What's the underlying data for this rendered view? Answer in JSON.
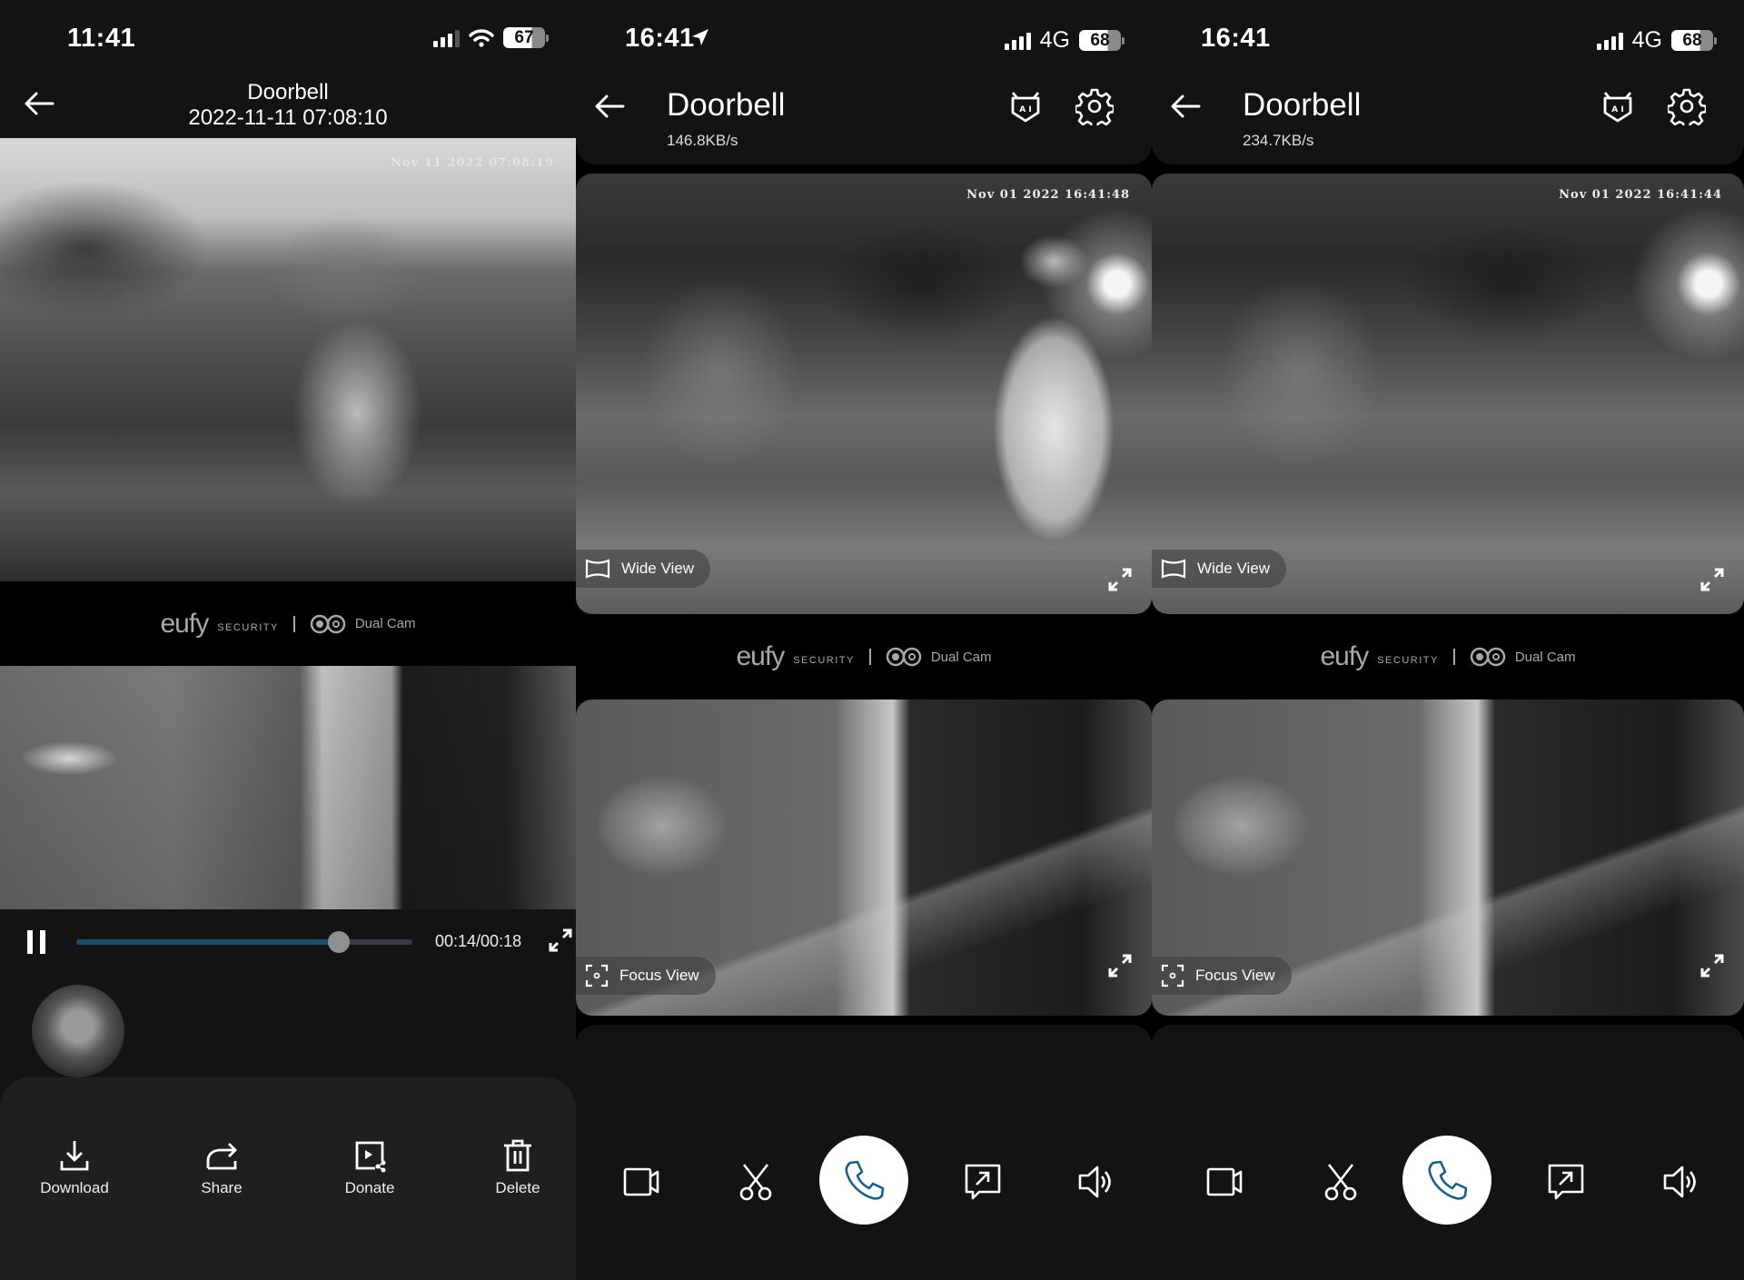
{
  "colors": {
    "accent": "#1a4d68",
    "call_icon": "#1a5f85",
    "sheet_bg": "#1e1f21",
    "header_bg": "#121315"
  },
  "playback_screen": {
    "status_bar": {
      "time": "11:41",
      "battery": "67",
      "network": "wifi"
    },
    "header": {
      "title": "Doorbell",
      "datetime": "2022-11-11 07:08:10"
    },
    "wide_feed": {
      "osd_timestamp": "Nov 11 2022 07:08:19"
    },
    "branding": {
      "brand": "eufy",
      "brand_sub": "SECURITY",
      "product": "Dual Cam"
    },
    "player": {
      "state": "playing",
      "elapsed": "00:14",
      "duration": "00:18",
      "time_label": "00:14/00:18",
      "progress_fraction": 0.78
    },
    "actions": [
      {
        "label": "Download",
        "icon": "download-icon"
      },
      {
        "label": "Share",
        "icon": "share-icon"
      },
      {
        "label": "Donate",
        "icon": "donate-video-icon"
      },
      {
        "label": "Delete",
        "icon": "trash-icon"
      }
    ]
  },
  "live_screens": [
    {
      "status_bar": {
        "time": "16:41",
        "network": "4G",
        "battery": "68",
        "location_active": true
      },
      "header": {
        "title": "Doorbell",
        "bitrate": "146.8KB/s"
      },
      "wide_feed": {
        "osd_timestamp": "Nov 01 2022  16:41:48",
        "label": "Wide View"
      },
      "branding": {
        "brand": "eufy",
        "brand_sub": "SECURITY",
        "product": "Dual Cam"
      },
      "focus_feed": {
        "label": "Focus View"
      },
      "controls": [
        "record-video-icon",
        "scissors-icon",
        "phone-icon",
        "quick-reply-icon",
        "speaker-icon"
      ]
    },
    {
      "status_bar": {
        "time": "16:41",
        "network": "4G",
        "battery": "68",
        "location_active": false
      },
      "header": {
        "title": "Doorbell",
        "bitrate": "234.7KB/s"
      },
      "wide_feed": {
        "osd_timestamp": "Nov 01 2022  16:41:44",
        "label": "Wide View"
      },
      "branding": {
        "brand": "eufy",
        "brand_sub": "SECURITY",
        "product": "Dual Cam"
      },
      "focus_feed": {
        "label": "Focus View"
      },
      "controls": [
        "record-video-icon",
        "scissors-icon",
        "phone-icon",
        "quick-reply-icon",
        "speaker-icon"
      ]
    }
  ]
}
